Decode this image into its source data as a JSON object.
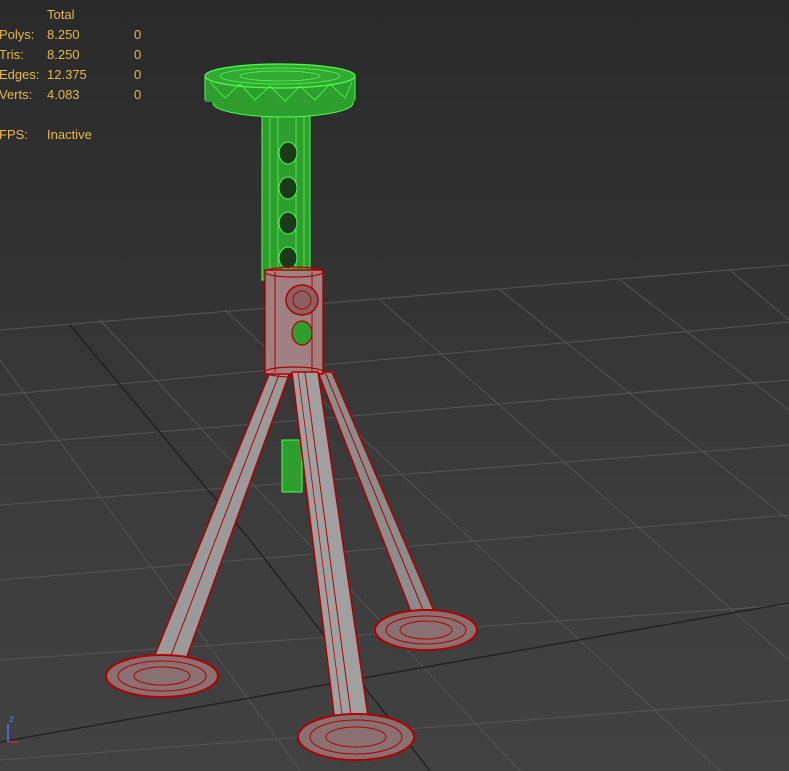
{
  "viewport": {
    "background_color": "#3a3a3a",
    "grid_color": "#555555",
    "grid_major_color": "#1a1a1a"
  },
  "stats": {
    "header": "Total",
    "rows": [
      {
        "label": "Polys:",
        "total": "8.250",
        "selected": "0"
      },
      {
        "label": "Tris:",
        "total": "8.250",
        "selected": "0"
      },
      {
        "label": "Edges:",
        "total": "12.375",
        "selected": "0"
      },
      {
        "label": "Verts:",
        "total": "4.083",
        "selected": "0"
      }
    ],
    "fps_label": "FPS:",
    "fps_value": "Inactive",
    "text_color": "#e8b84a"
  },
  "model": {
    "upper_color": "#2e9e2e",
    "upper_wire_color": "#4cff4c",
    "lower_color": "#9a9a9a",
    "lower_wire_color": "#b00000"
  },
  "gizmo": {
    "axis_label": "z"
  }
}
